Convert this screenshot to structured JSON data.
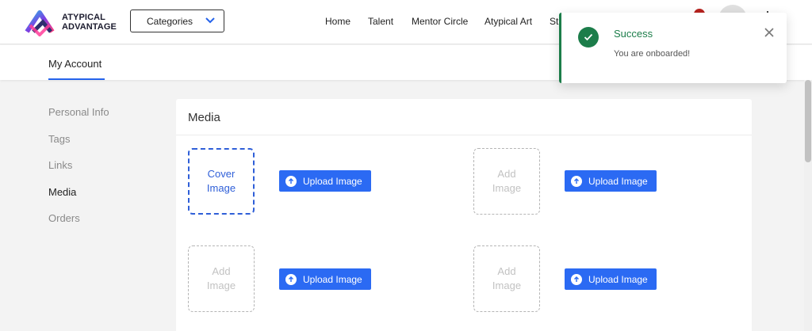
{
  "header": {
    "logo_line1": "ATYPICAL",
    "logo_line2": "ADVANTAGE",
    "categories_label": "Categories",
    "nav": [
      "Home",
      "Talent",
      "Mentor Circle",
      "Atypical Art",
      "St"
    ]
  },
  "subheader": {
    "tab_label": "My Account"
  },
  "sidebar": {
    "items": [
      {
        "label": "Personal Info",
        "active": false
      },
      {
        "label": "Tags",
        "active": false
      },
      {
        "label": "Links",
        "active": false
      },
      {
        "label": "Media",
        "active": true
      },
      {
        "label": "Orders",
        "active": false
      }
    ]
  },
  "media": {
    "title": "Media",
    "slots": [
      {
        "line1": "Cover",
        "line2": "Image",
        "kind": "cover",
        "button": "Upload Image"
      },
      {
        "line1": "Add",
        "line2": "Image",
        "kind": "empty",
        "button": "Upload Image"
      },
      {
        "line1": "Add",
        "line2": "Image",
        "kind": "empty",
        "button": "Upload Image"
      },
      {
        "line1": "Add",
        "line2": "Image",
        "kind": "empty",
        "button": "Upload Image"
      }
    ]
  },
  "toast": {
    "title": "Success",
    "message": "You are onboarded!"
  },
  "colors": {
    "accent": "#2b6af3",
    "success": "#1c7d4a",
    "notification": "#b8231f"
  },
  "icons": {
    "logo": "atypical-advantage-logo-icon",
    "categories": "chevron-down-icon",
    "upload": "arrow-up-circle-icon",
    "toast": "check-circle-icon",
    "close": "close-icon",
    "power": "power-icon"
  }
}
